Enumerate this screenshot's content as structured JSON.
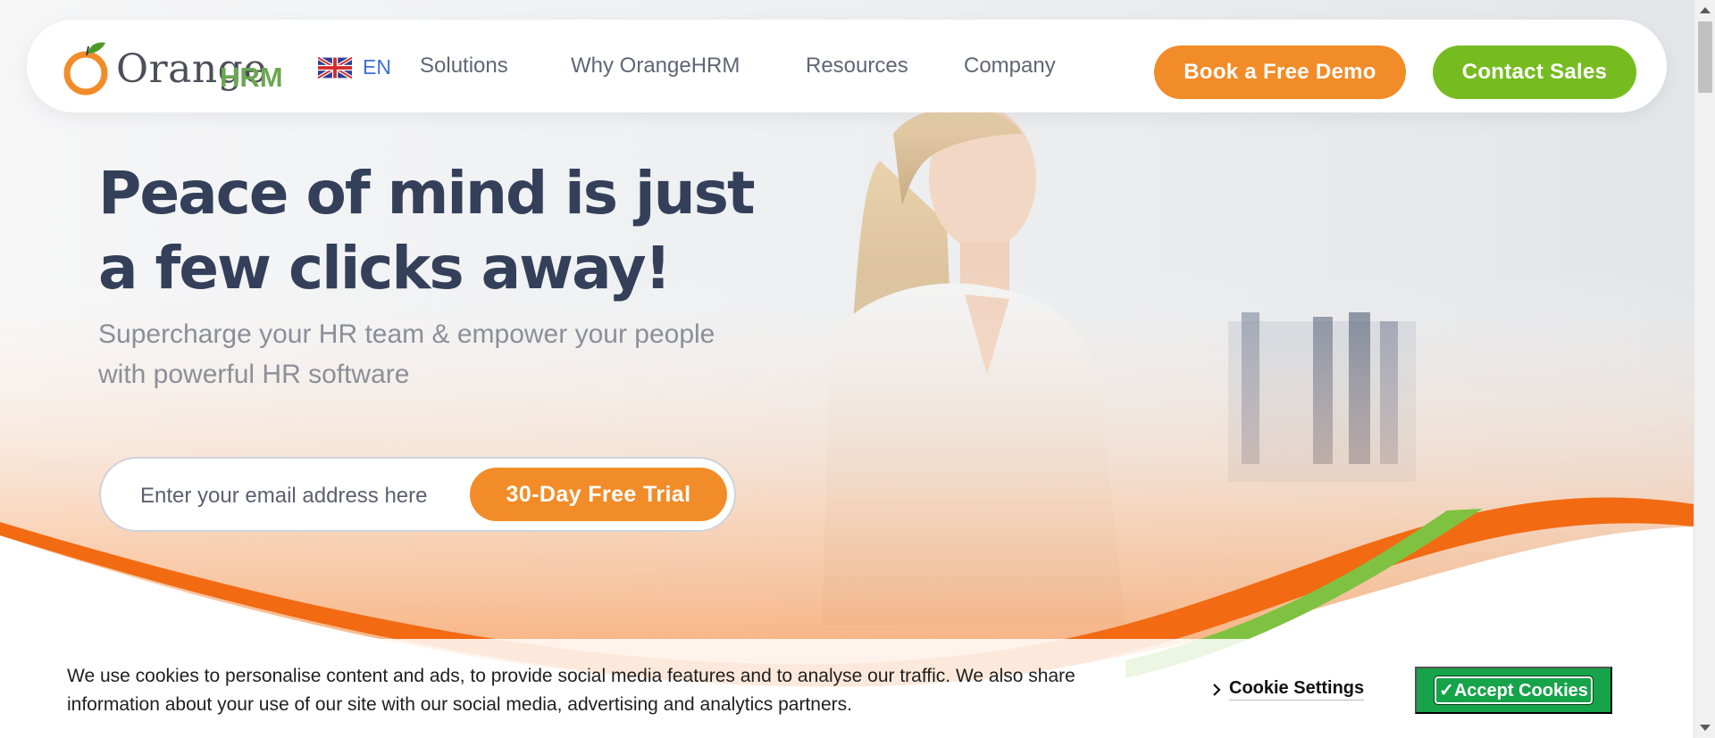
{
  "navbar": {
    "logo_text": "Orange",
    "logo_suffix": "HRM",
    "language": "EN",
    "items": [
      {
        "label": "Solutions"
      },
      {
        "label": "Why OrangeHRM"
      },
      {
        "label": "Resources"
      },
      {
        "label": "Company"
      }
    ],
    "demo_button": "Book a Free Demo",
    "sales_button": "Contact Sales"
  },
  "hero": {
    "headline": "Peace of mind is just a few clicks away!",
    "subheadline": "Supercharge your HR team & empower your people with powerful HR software",
    "email_placeholder": "Enter your email address here",
    "trial_button": "30-Day Free Trial"
  },
  "cookie_banner": {
    "text": "We use cookies to personalise content and ads, to provide social media features and to analyse our traffic. We also share information about your use of our site with our social media, advertising and analytics partners.",
    "settings_label": "Cookie Settings",
    "accept_label": "✓Accept Cookies"
  },
  "colors": {
    "brand_orange": "#f28c28",
    "brand_green": "#76bc21",
    "headline_navy": "#34405a",
    "accept_green": "#17a34a"
  },
  "icons": [
    "orange-fruit-icon",
    "uk-flag-icon",
    "chevron-right-icon"
  ]
}
